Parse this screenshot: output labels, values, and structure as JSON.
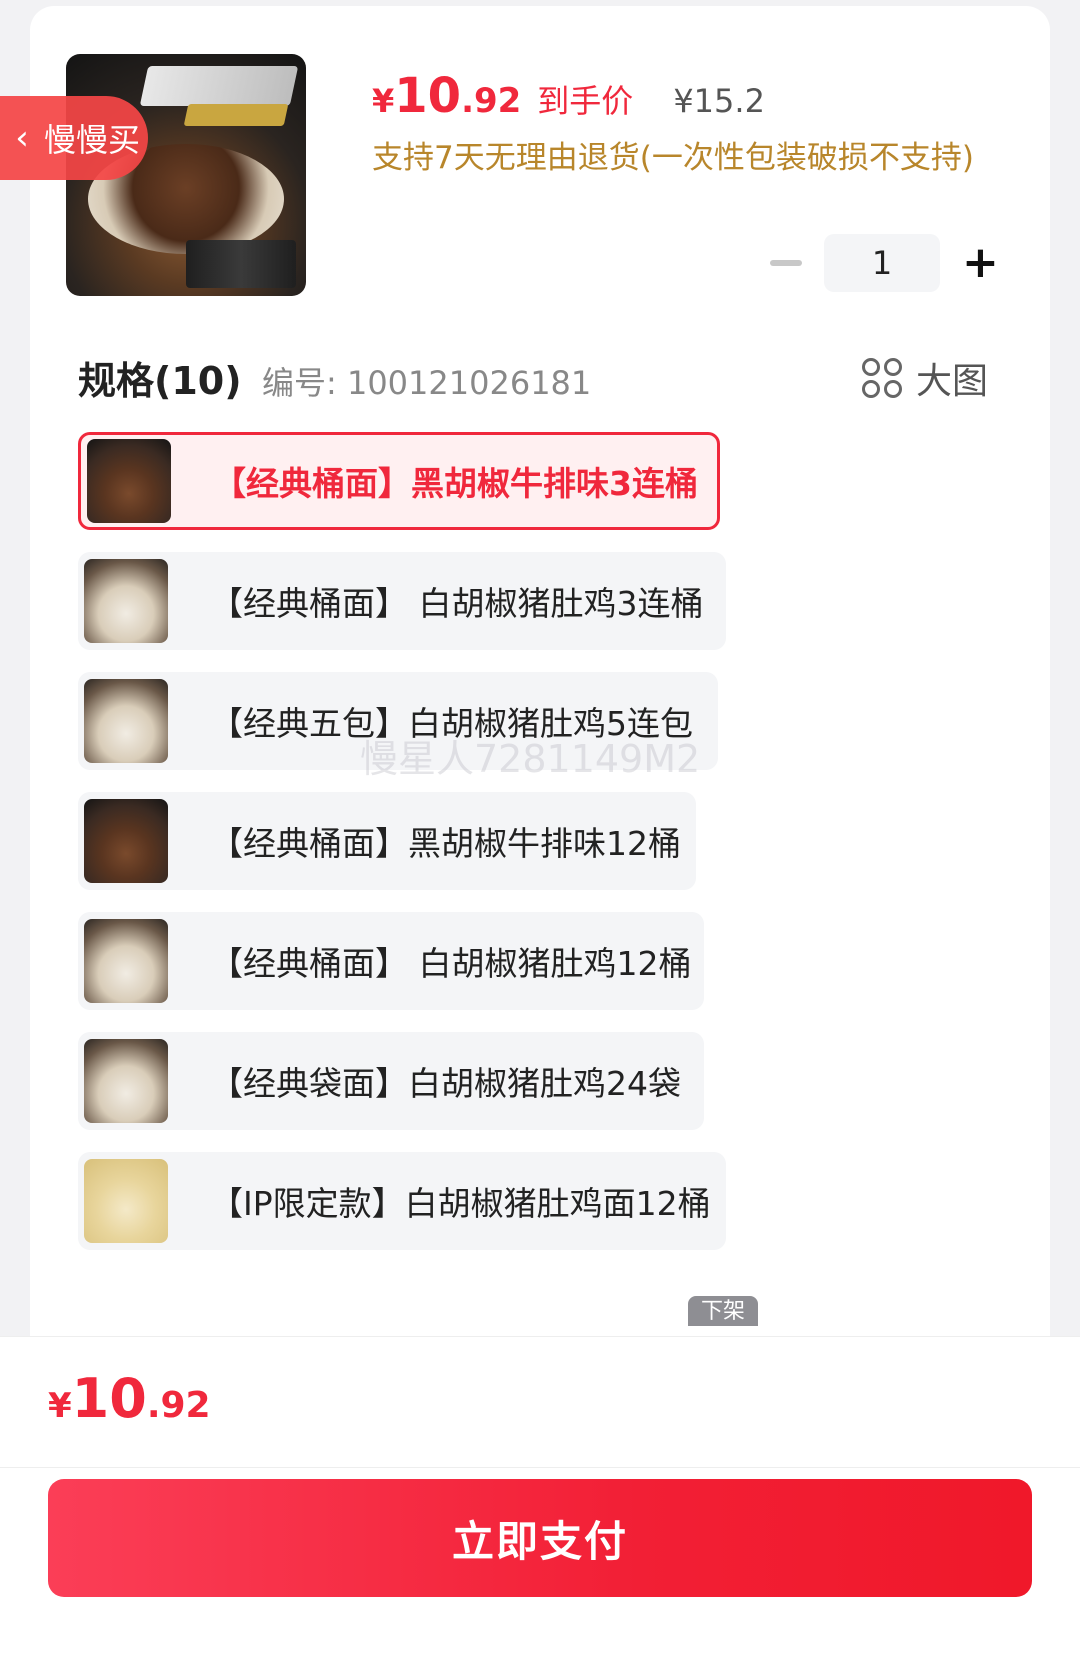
{
  "product": {
    "price_yen": "¥",
    "price_integer": "10",
    "price_decimal": ".92",
    "price_label": "到手价",
    "original_price": "¥15.2",
    "return_policy": "支持7天无理由退货(一次性包装破损不支持)"
  },
  "slow_buy_tag": {
    "label": "慢慢买",
    "icon": "chevron-left-icon"
  },
  "quantity": {
    "value": "1",
    "minus_icon": "minus-icon",
    "plus_label": "+"
  },
  "specs": {
    "title": "规格(10)",
    "code_label": "编号: 100121026181",
    "big_image_label": "大图",
    "items": [
      {
        "label": "【经典桶面】黑胡椒牛排味3连桶",
        "selected": true
      },
      {
        "label": "【经典桶面】 白胡椒猪肚鸡3连桶"
      },
      {
        "label": "【经典五包】白胡椒猪肚鸡5连包"
      },
      {
        "label": "【经典桶面】黑胡椒牛排味12桶"
      },
      {
        "label": "【经典桶面】 白胡椒猪肚鸡12桶"
      },
      {
        "label": "【经典袋面】白胡椒猪肚鸡24袋"
      },
      {
        "label": "【IP限定款】白胡椒猪肚鸡面12桶"
      }
    ],
    "partial_badge": "下架"
  },
  "watermark": "慢星人7281149M2",
  "footer": {
    "total_yen": "¥",
    "total_integer": "10",
    "total_decimal": ".92",
    "pay_button": "立即支付"
  },
  "colors": {
    "accent": "#f0283c",
    "gold_text": "#b8862b"
  }
}
